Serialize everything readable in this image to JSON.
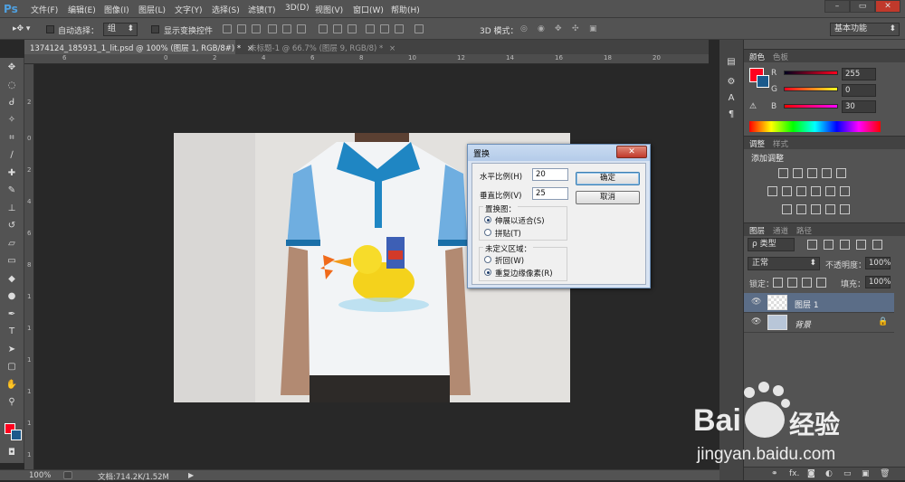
{
  "app": {
    "logo": "Ps"
  },
  "menu": [
    "文件(F)",
    "编辑(E)",
    "图像(I)",
    "图层(L)",
    "文字(Y)",
    "选择(S)",
    "滤镜(T)",
    "3D(D)",
    "视图(V)",
    "窗口(W)",
    "帮助(H)"
  ],
  "window_controls": {
    "minimize": "–",
    "maximize": "▭",
    "close": "✕"
  },
  "options": {
    "auto_select_label": "自动选择：",
    "auto_select_value": "组",
    "show_transform_label": "显示变换控件",
    "mode_3d_label": "3D 模式：",
    "workspace": "基本功能"
  },
  "tabs": [
    {
      "label": "1374124_185931_1_lit.psd @ 100% (图层 1, RGB/8#) *",
      "close": "×"
    },
    {
      "label": "未标题-1 @ 66.7% (图层 9, RGB/8) *",
      "close": "×"
    }
  ],
  "ruler": {
    "top": [
      "6",
      "0",
      "2",
      "4",
      "6",
      "8",
      "10",
      "12",
      "14",
      "16",
      "18",
      "20"
    ],
    "left": [
      "2",
      "0",
      "2",
      "4",
      "6",
      "8",
      "1",
      "1",
      "1",
      "1",
      "1",
      "1",
      "1"
    ]
  },
  "status": {
    "zoom": "100%",
    "doc": "文档:714.2K/1.52M",
    "arrow": "▶"
  },
  "color_panel": {
    "tabs": [
      "颜色",
      "色板"
    ],
    "r_label": "R",
    "g_label": "G",
    "b_label": "B",
    "r_value": "255",
    "g_value": "0",
    "b_value": "30",
    "fg_color": "#ff001e",
    "bg_color": "#1b5a8c"
  },
  "adjust_panel": {
    "tabs": [
      "调整",
      "样式"
    ],
    "title": "添加调整"
  },
  "layers_panel": {
    "tabs": [
      "图层",
      "通道",
      "路径"
    ],
    "filter_label": "ρ 类型",
    "blend_mode": "正常",
    "opacity_label": "不透明度：",
    "opacity_value": "100%",
    "lock_label": "锁定：",
    "fill_label": "填充：",
    "fill_value": "100%",
    "layers": [
      {
        "name": "图层 1",
        "selected": true
      },
      {
        "name": "背景",
        "selected": false,
        "locked": true
      }
    ],
    "footer_icons": [
      "link-icon",
      "fx-icon",
      "mask-icon",
      "adjustment-icon",
      "folder-icon",
      "new-layer-icon",
      "trash-icon"
    ],
    "fx_text": "fx."
  },
  "dialog": {
    "title": "置换",
    "close": "✕",
    "h_scale_label": "水平比例(H)",
    "h_scale_value": "20",
    "v_scale_label": "垂直比例(V)",
    "v_scale_value": "25",
    "map_group_label": "置换图：",
    "map_stretch": "伸展以适合(S)",
    "map_tile": "拼贴(T)",
    "undefined_group_label": "未定义区域：",
    "wrap": "折回(W)",
    "repeat_edge": "重复边缘像素(R)",
    "ok": "确定",
    "cancel": "取消"
  },
  "watermark": {
    "brand": "Bai",
    "brand2": "经验",
    "url": "jingyan.baidu.com"
  }
}
